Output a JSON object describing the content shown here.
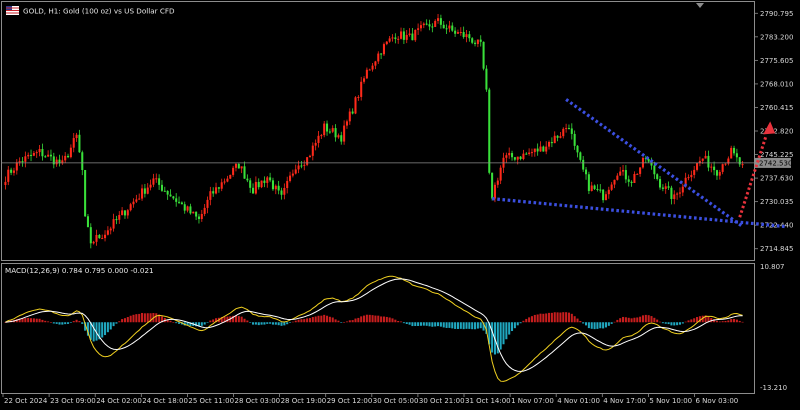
{
  "header": {
    "symbol_text": "GOLD, H1:  Gold (100 oz) vs US Dollar CFD",
    "flag_icon": "uk-flag-icon"
  },
  "colors": {
    "background": "#000000",
    "bull": "#ff2a1a",
    "bear": "#39e03a",
    "grid_line": "#8c8c8c",
    "pattern_line": "#3b4fe0",
    "arrow": "#e8323c",
    "macd_line": "#f0d020",
    "signal_line": "#ffffff",
    "hist_pos": "#c81e1e",
    "hist_neg": "#20a8c0",
    "price_tag_bg": "#8c8c8c"
  },
  "chart_data": [
    {
      "type": "candlestick",
      "title": "GOLD, H1:  Gold (100 oz) vs US Dollar CFD",
      "y_ticks": [
        "2790.795",
        "2783.200",
        "2775.605",
        "2768.010",
        "2760.415",
        "2752.820",
        "2745.225",
        "2737.630",
        "2730.035",
        "2722.440",
        "2714.845"
      ],
      "ylim": [
        2712.5,
        2792.5
      ],
      "current_price": "2742.530",
      "x_ticks": [
        "22 Oct 2024",
        "23 Oct 09:00",
        "24 Oct 02:00",
        "24 Oct 18:00",
        "25 Oct 11:00",
        "28 Oct 03:00",
        "28 Oct 19:00",
        "29 Oct 12:00",
        "30 Oct 05:00",
        "30 Oct 21:00",
        "31 Oct 14:00",
        "1 Nov 07:00",
        "4 Nov 01:00",
        "4 Nov 17:00",
        "5 Nov 10:00",
        "6 Nov 03:00"
      ],
      "close_path": [
        [
          0,
          2738
        ],
        [
          5,
          2743
        ],
        [
          12,
          2746
        ],
        [
          20,
          2742
        ],
        [
          25,
          2751
        ],
        [
          27,
          2740
        ],
        [
          28,
          2724
        ],
        [
          30,
          2717
        ],
        [
          35,
          2720
        ],
        [
          40,
          2725
        ],
        [
          47,
          2732
        ],
        [
          52,
          2737
        ],
        [
          57,
          2733
        ],
        [
          63,
          2728
        ],
        [
          68,
          2724
        ],
        [
          72,
          2732
        ],
        [
          77,
          2737
        ],
        [
          82,
          2742
        ],
        [
          87,
          2734
        ],
        [
          92,
          2738
        ],
        [
          97,
          2731
        ],
        [
          102,
          2742
        ],
        [
          106,
          2744
        ],
        [
          112,
          2754
        ],
        [
          118,
          2751
        ],
        [
          122,
          2760
        ],
        [
          127,
          2772
        ],
        [
          132,
          2779
        ],
        [
          137,
          2784
        ],
        [
          142,
          2783
        ],
        [
          147,
          2786
        ],
        [
          152,
          2788
        ],
        [
          157,
          2785
        ],
        [
          163,
          2783
        ],
        [
          167,
          2780
        ],
        [
          169,
          2765
        ],
        [
          170,
          2738
        ],
        [
          171,
          2732
        ],
        [
          175,
          2744
        ],
        [
          182,
          2745
        ],
        [
          188,
          2747
        ],
        [
          195,
          2752
        ],
        [
          198,
          2755
        ],
        [
          200,
          2747
        ],
        [
          205,
          2735
        ],
        [
          210,
          2732
        ],
        [
          215,
          2740
        ],
        [
          220,
          2737
        ],
        [
          225,
          2744
        ],
        [
          230,
          2736
        ],
        [
          235,
          2731
        ],
        [
          240,
          2739
        ],
        [
          245,
          2744
        ],
        [
          250,
          2740
        ],
        [
          255,
          2746
        ],
        [
          259,
          2741
        ]
      ],
      "pattern": {
        "upper_line": [
          [
            197,
            2763
          ],
          [
            259,
            2722
          ]
        ],
        "lower_line": [
          [
            171,
            2731
          ],
          [
            274,
            2722
          ]
        ],
        "arrow": [
          [
            258,
            2725
          ],
          [
            268,
            2754
          ]
        ]
      }
    },
    {
      "type": "macd",
      "label": "MACD(12,26,9) 0.784 0.795 0.000 -0.021",
      "y_ticks": [
        "10.807",
        "-13.210"
      ],
      "ylim": [
        -13.21,
        10.807
      ]
    }
  ]
}
